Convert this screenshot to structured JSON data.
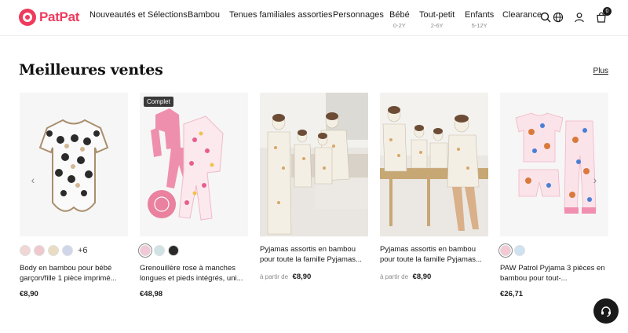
{
  "brand": {
    "name": "PatPat",
    "color": "#ee3b5d"
  },
  "nav": [
    {
      "label": "Nouveautés et Sélections",
      "sub": ""
    },
    {
      "label": "Bambou",
      "sub": ""
    },
    {
      "label": "Tenues familiales assorties",
      "sub": ""
    },
    {
      "label": "Personnages",
      "sub": ""
    },
    {
      "label": "Bébé",
      "sub": "0-2Y"
    },
    {
      "label": "Tout-petit",
      "sub": "2-6Y"
    },
    {
      "label": "Enfants",
      "sub": "5-12Y"
    },
    {
      "label": "Clearance",
      "sub": ""
    }
  ],
  "header_icons": [
    "search-icon",
    "globe-icon",
    "user-icon",
    "cart-icon"
  ],
  "cart_count": "0",
  "section": {
    "title": "Meilleures ventes",
    "more_label": "Plus"
  },
  "products": [
    {
      "badge": "",
      "swatches": [
        "#f1d7d4",
        "#efc9cd",
        "#e9dcc2",
        "#cfd6ea"
      ],
      "more_swatches": "+6",
      "title": "Body en bambou pour bébé garçon/fille 1 pièce imprimé...",
      "price_prefix": "",
      "price": "€8,90"
    },
    {
      "badge": "Complet",
      "swatches": [
        "#f2c8d6",
        "#cfe3e5",
        "#2a2a2a"
      ],
      "more_swatches": "",
      "title": "Grenouillère rose à manches longues et pieds intégrés, uni...",
      "price_prefix": "",
      "price": "€48,98"
    },
    {
      "badge": "",
      "swatches": [],
      "more_swatches": "",
      "title": "Pyjamas assortis en bambou pour toute la famille Pyjamas...",
      "price_prefix": "à partir de",
      "price": "€8,90"
    },
    {
      "badge": "",
      "swatches": [],
      "more_swatches": "",
      "title": "Pyjamas assortis en bambou pour toute la famille Pyjamas...",
      "price_prefix": "à partir de",
      "price": "€8,90"
    },
    {
      "badge": "",
      "swatches": [
        "#f4c9d4",
        "#cfe2f2"
      ],
      "more_swatches": "",
      "title": "PAW Patrol Pyjama 3 pièces en bambou pour tout-...",
      "price_prefix": "",
      "price": "€26,71"
    }
  ]
}
